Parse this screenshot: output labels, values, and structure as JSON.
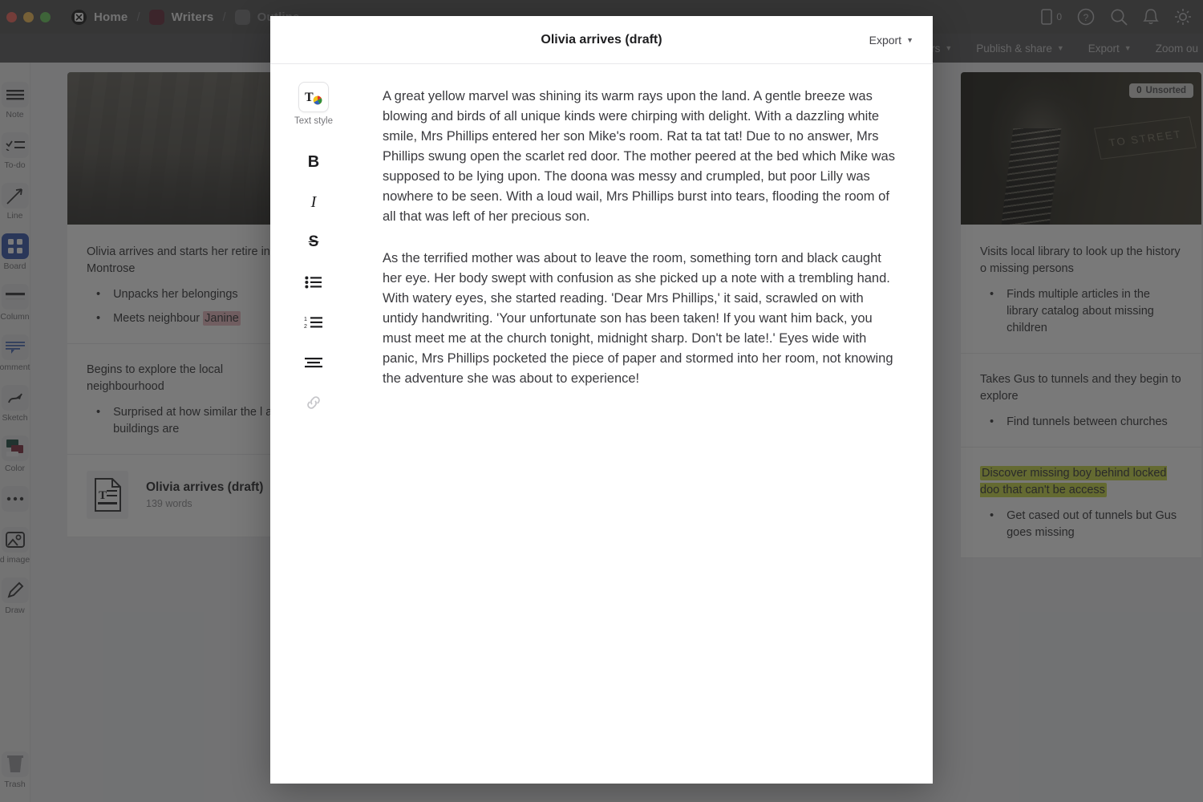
{
  "titlebar": {
    "breadcrumbs": [
      {
        "label": "Home",
        "icon": "app-logo-icon",
        "type": "app"
      },
      {
        "label": "Writers",
        "icon": "color-swatch",
        "color": "#5e2130",
        "type": "swatch"
      },
      {
        "label": "Outline",
        "icon": "color-swatch",
        "color": "#6e6e71",
        "type": "swatch",
        "muted": true
      }
    ],
    "separator": "/",
    "actions": [
      {
        "name": "device-icon",
        "label": "",
        "count": "0"
      },
      {
        "name": "help-icon",
        "label": ""
      },
      {
        "name": "search-icon",
        "label": ""
      },
      {
        "name": "notifications-bell-icon",
        "label": ""
      },
      {
        "name": "settings-gear-icon",
        "label": ""
      }
    ]
  },
  "subbar": {
    "items": [
      {
        "label": "Editors",
        "caret": true
      },
      {
        "label": "Publish & share",
        "caret": true
      },
      {
        "label": "Export",
        "caret": true
      },
      {
        "label": "Zoom ou",
        "caret": false
      }
    ]
  },
  "rail": {
    "items": [
      {
        "label": "Note",
        "icon": "note-icon",
        "active": false
      },
      {
        "label": "To-do",
        "icon": "todo-checklist-icon",
        "active": false
      },
      {
        "label": "Line",
        "icon": "line-arrow-icon",
        "active": false
      },
      {
        "label": "Board",
        "icon": "board-grid-icon",
        "active": true
      },
      {
        "label": "Column",
        "icon": "column-icon",
        "active": false
      },
      {
        "label": "omment",
        "icon": "comment-icon",
        "active": false
      },
      {
        "label": "Sketch",
        "icon": "sketch-icon",
        "active": false
      },
      {
        "label": "Color",
        "icon": "color-swatches-icon",
        "active": false
      },
      {
        "label": "",
        "icon": "more-dots-icon",
        "active": false
      },
      {
        "label": "d image",
        "icon": "add-image-icon",
        "active": false
      },
      {
        "label": "Draw",
        "icon": "draw-pencil-icon",
        "active": false
      }
    ],
    "bottom": {
      "label": "Trash",
      "icon": "trash-icon"
    }
  },
  "canvas": {
    "left_column": {
      "hero": {
        "name": "vintage-street-photo",
        "caption": ""
      },
      "cards": [
        {
          "title_before": "Olivia arrives and starts her retire",
          "title_after": " in Montrose",
          "title": "Olivia arrives and starts her retire in Montrose",
          "bullets": [
            {
              "text": "Unpacks her belongings"
            },
            {
              "text_before": "Meets neighbour ",
              "highlight": "Janine",
              "highlight_color": "#e8b6bd"
            }
          ]
        },
        {
          "title": "Begins to explore the local neighbourhood",
          "bullets": [
            {
              "text": "Surprised at how similar the l and buildings are"
            }
          ]
        }
      ],
      "document": {
        "name": "Olivia arrives (draft)",
        "meta": "139 words",
        "icon": "text-document-icon"
      }
    },
    "right_column": {
      "hero": {
        "name": "dark-tunnel-stairway-photo",
        "sign_text": "TO STREET",
        "badge_count": "0",
        "badge_label": "Unsorted"
      },
      "cards": [
        {
          "title": "Visits local library to look up the history o missing persons",
          "bullets": [
            {
              "text": "Finds multiple articles in the library catalog about missing children"
            }
          ]
        },
        {
          "title": "Takes Gus to tunnels and they begin to explore",
          "bullets": [
            {
              "text": "Find tunnels between churches"
            }
          ]
        },
        {
          "title_highlight": "Discover missing boy behind locked doo that can't be access",
          "highlight_color": "#c6d63f",
          "bullets": [
            {
              "text": "Get cased out of tunnels but Gus goes missing"
            }
          ]
        }
      ]
    }
  },
  "modal": {
    "title": "Olivia arrives (draft)",
    "export_label": "Export",
    "toolbar": {
      "text_style_label": "Text style",
      "buttons": [
        {
          "name": "text-style-button",
          "glyph": "T"
        },
        {
          "name": "bold-button",
          "glyph": "B"
        },
        {
          "name": "italic-button",
          "glyph": "I"
        },
        {
          "name": "strikethrough-button",
          "glyph": "S"
        },
        {
          "name": "bulleted-list-button",
          "glyph": ""
        },
        {
          "name": "numbered-list-button",
          "glyph": ""
        },
        {
          "name": "align-button",
          "glyph": ""
        },
        {
          "name": "link-button",
          "glyph": ""
        }
      ]
    },
    "paragraphs": [
      "A great yellow marvel was shining its warm rays upon the land. A gentle breeze was blowing and birds of all unique kinds were chirping with delight. With a dazzling white smile, Mrs Phillips entered her son Mike's room. Rat ta tat tat! Due to no answer, Mrs Phillips swung open the scarlet red door. The mother peered at the bed which Mike was supposed to be lying upon. The doona was messy and crumpled, but poor Lilly was nowhere to be seen. With a loud wail, Mrs Phillips burst into tears, flooding the room of all that was left of her precious son.",
      "As the terrified mother was about to leave the room, something torn and black caught her eye. Her body swept with confusion as she picked up a note with a trembling hand. With watery eyes, she started reading. 'Dear Mrs Phillips,' it said, scrawled on with untidy handwriting. 'Your unfortunate son has been taken! If you want him back, you must meet me at the church tonight, midnight sharp. Don't be late!.' Eyes wide with panic, Mrs Phillips pocketed the piece of paper and stormed into her room, not knowing the adventure she was about to experience!"
    ]
  }
}
